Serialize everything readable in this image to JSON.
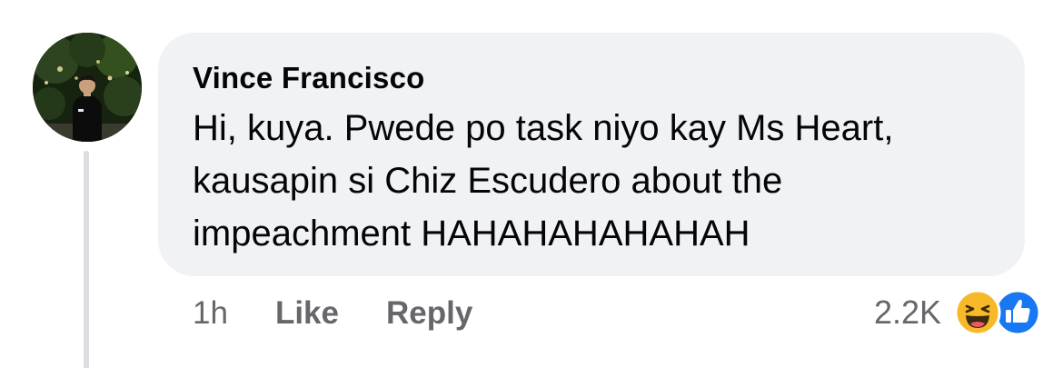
{
  "comment": {
    "author": "Vince Francisco",
    "text": "Hi, kuya. Pwede po task niyo kay Ms Heart, kausapin si Chiz Escudero about the impeachment HAHAHAHAHAHAH",
    "time": "1h",
    "like_label": "Like",
    "reply_label": "Reply",
    "reaction_count": "2.2K",
    "reactions": [
      "haha-icon",
      "like-icon"
    ]
  },
  "colors": {
    "bubble": "#f0f2f5",
    "text": "#050505",
    "meta": "#65676b",
    "like_blue": "#1877f2",
    "haha_yellow": "#f7b928"
  }
}
